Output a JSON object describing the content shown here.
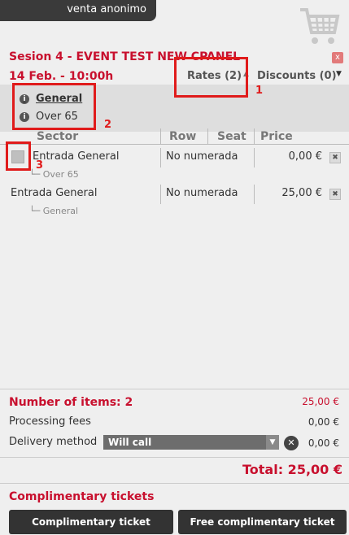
{
  "header": {
    "user_tab": "venta anonimo"
  },
  "icons": {
    "cart": "shopping-cart-icon",
    "close": "close-icon"
  },
  "colors": {
    "accent": "#c8102e",
    "highlight": "#e01b1b"
  },
  "session": {
    "title": "Sesion 4 - EVENT TEST NEW CPANEL",
    "date": "14 Feb. - 10:00h",
    "close_label": "x"
  },
  "tabs": {
    "rates": "Rates (2)",
    "rates_arrow": "▲",
    "discounts": "Discounts (0)",
    "discounts_arrow": "▼"
  },
  "rates": [
    {
      "label": "General",
      "info_icon": "i"
    },
    {
      "label": "Over 65",
      "info_icon": "i"
    }
  ],
  "table": {
    "headers": {
      "sector": "Sector",
      "row": "Row",
      "seat": "Seat",
      "price": "Price"
    },
    "rows": [
      {
        "sector": "Entrada General",
        "rate": "└─ Over 65",
        "row": "No numerada",
        "price": "0,00 €",
        "delete": "✖"
      },
      {
        "sector": "Entrada General",
        "rate": "└─ General",
        "row": "No numerada",
        "price": "25,00 €",
        "delete": "✖"
      }
    ]
  },
  "summary": {
    "items_label": "Number of items: 2",
    "items_value": "25,00 €",
    "fees_label": "Processing fees",
    "fees_value": "0,00 €",
    "delivery_label": "Delivery method",
    "delivery_selected": "Will call",
    "delivery_arrow": "▼",
    "delivery_clear": "✕",
    "delivery_value": "0,00 €",
    "total": "Total: 25,00 €"
  },
  "complimentary": {
    "title": "Complimentary tickets",
    "button_comp": "Complimentary ticket",
    "button_free": "Free complimentary ticket"
  },
  "annotations": {
    "one": "1",
    "two": "2",
    "three": "3"
  }
}
